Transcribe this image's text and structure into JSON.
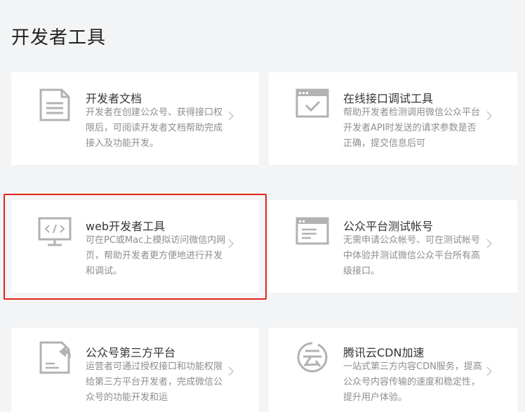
{
  "page": {
    "title": "开发者工具"
  },
  "colors": {
    "background": "#f3f4f5",
    "card": "#ffffff",
    "icon": "#b2b2b2",
    "highlight": "#e1251b",
    "desc": "#8d8d8d"
  },
  "tools": [
    {
      "title": "开发者文档",
      "desc": "开发者在创建公众号、获得接口权限后，可阅读开发者文档帮助完成接入及功能开发。",
      "icon": "document-icon"
    },
    {
      "title": "在线接口调试工具",
      "desc": "帮助开发者检测调用微信公众平台开发者API时发送的请求参数是否正确，提交信息后可",
      "icon": "debug-window-icon"
    },
    {
      "title": "web开发者工具",
      "desc": "可在PC或Mac上模拟访问微信内网页，帮助开发者更方便地进行开发和调试。",
      "icon": "code-monitor-icon",
      "highlighted": true
    },
    {
      "title": "公众平台测试帐号",
      "desc": "无需申请公众帐号、可在测试帐号中体验并测试微信公众平台所有高级接口。",
      "icon": "test-account-icon"
    },
    {
      "title": "公众号第三方平台",
      "desc": "运营者可通过授权接口和功能权限给第三方平台开发者，完成微信公众号的功能开发和运",
      "icon": "third-party-icon"
    },
    {
      "title": "腾讯云CDN加速",
      "desc": "一站式第三方内容CDN服务，提高公众号内容传输的速度和稳定性，提升用户体验。",
      "icon": "cloud-cdn-icon"
    }
  ]
}
